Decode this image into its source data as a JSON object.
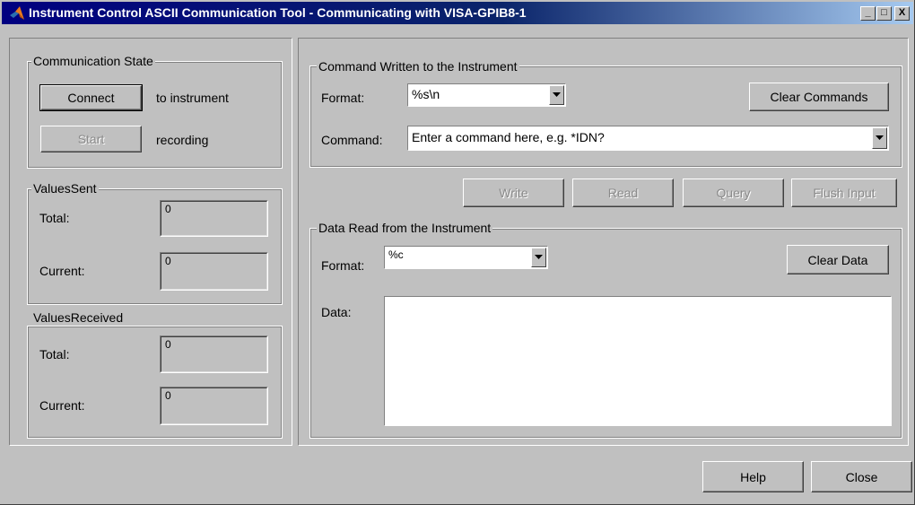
{
  "window": {
    "title": "Instrument Control ASCII Communication Tool - Communicating with VISA-GPIB8-1",
    "minimize_glyph": "_",
    "maximize_glyph": "□",
    "close_glyph": "X"
  },
  "communication_state": {
    "label": "Communication State",
    "connect_button": "Connect",
    "connect_caption": "to instrument",
    "start_button": "Start",
    "start_caption": "recording"
  },
  "values_sent": {
    "label": "ValuesSent",
    "total_label": "Total:",
    "total_value": "0",
    "current_label": "Current:",
    "current_value": "0"
  },
  "values_received": {
    "label": "ValuesReceived",
    "total_label": "Total:",
    "total_value": "0",
    "current_label": "Current:",
    "current_value": "0"
  },
  "command_written": {
    "label": "Command Written to the Instrument",
    "format_label": "Format:",
    "format_value": "%s\\n",
    "clear_button": "Clear Commands",
    "command_label": "Command:",
    "command_value": "Enter a command here, e.g. *IDN?"
  },
  "actions": {
    "write": "Write",
    "read": "Read",
    "query": "Query",
    "flush": "Flush Input"
  },
  "data_read": {
    "label": "Data Read from the Instrument",
    "format_label": "Format:",
    "format_value": "%c",
    "clear_button": "Clear Data",
    "data_label": "Data:",
    "data_value": ""
  },
  "footer": {
    "help_button": "Help",
    "close_button": "Close"
  }
}
